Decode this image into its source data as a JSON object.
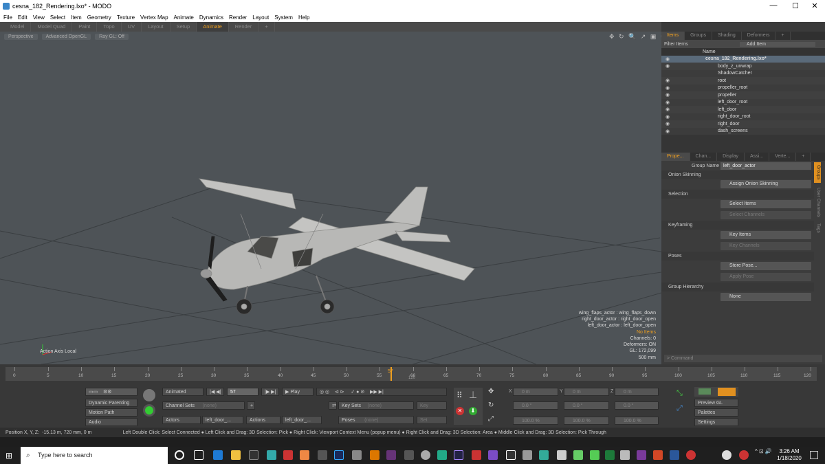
{
  "window": {
    "title": "cesna_182_Rendering.lxo* - MODO",
    "controls": [
      "—",
      "☐",
      "✕"
    ]
  },
  "menu": [
    "File",
    "Edit",
    "View",
    "Select",
    "Item",
    "Geometry",
    "Texture",
    "Vertex Map",
    "Animate",
    "Dynamics",
    "Render",
    "Layout",
    "System",
    "Help"
  ],
  "layout_tabs": [
    "Model",
    "Model Quad",
    "Paint",
    "Topo",
    "UV",
    "Layout",
    "Setup",
    "Animate",
    "Render",
    "+"
  ],
  "active_layout_tab": "Animate",
  "viewport": {
    "view": "Perspective",
    "shading": "Advanced OpenGL",
    "raygl": "Ray GL: Off",
    "axis_label": "Action Axis Local",
    "overlay": [
      "wing_flaps_actor : wing_flaps_down",
      "right_door_actor : right_door_open",
      "left_door_actor : left_door_open"
    ],
    "no_items": "No Items",
    "stats": [
      "Channels: 0",
      "Deformers: ON",
      "GL: 172,099",
      "500 mm"
    ],
    "tools": "✥ ↻ 🔍 ↗ ▣ ⚙"
  },
  "items_panel": {
    "tabs": [
      "Items",
      "Groups",
      "Shading",
      "Deformers",
      "+"
    ],
    "filter_placeholder": "Filter Items",
    "add_item": "Add Item",
    "name_header": "Name",
    "items": [
      "cesna_182_Rendering.lxo*",
      "body_z_unwrap",
      "ShadowCatcher",
      "root",
      "propeller_root",
      "propeller",
      "left_door_root",
      "left_door",
      "right_door_root",
      "right_door",
      "dash_screens"
    ]
  },
  "properties_panel": {
    "tabs": [
      "Prope...",
      "Chan...",
      "Display",
      "Assi...",
      "Verte...",
      "+"
    ],
    "group_name_label": "Group Name",
    "group_name_value": "left_door_actor",
    "sections": [
      "Onion Skinning",
      "Selection",
      "Keyframing",
      "Poses",
      "Group Hierarchy"
    ],
    "buttons": [
      "Assign Onion Skinning",
      "Select Items",
      "Select Channels",
      "Key Items",
      "Key Channels",
      "Store Pose...",
      "Apply Pose",
      "None"
    ],
    "side_tabs": [
      "Groups",
      "User Channels",
      "Tags"
    ],
    "command_placeholder": "Command"
  },
  "timeline": {
    "ticks": [
      "0",
      "5",
      "10",
      "15",
      "20",
      "25",
      "30",
      "35",
      "40",
      "45",
      "50",
      "55",
      "60",
      "65",
      "70",
      "75",
      "80",
      "85",
      "90",
      "95",
      "100",
      "105",
      "110",
      "115",
      "120"
    ],
    "current": "57",
    "end_marker": "120"
  },
  "transport": {
    "left_buttons": [
      "Dynamic Parenting",
      "Motion Path",
      "Audio"
    ],
    "mode": "Animated",
    "frame": "57",
    "play": "Play",
    "channel_sets": "Channel Sets",
    "channel_sets_value": "(none)",
    "key_sets": "Key Sets",
    "key_sets_value": "(none)",
    "key": "Key",
    "actors": "Actors",
    "actor_value": "left_door_...",
    "actions": "Actions",
    "action_value": "left_door_...",
    "poses": "Poses",
    "poses_value": "(none)",
    "set": "Set",
    "xyz_rows": [
      [
        "0 m",
        "0 m",
        "0 m"
      ],
      [
        "0.0 °",
        "0.0 °",
        "0.0 °"
      ],
      [
        "100.0 %",
        "100.0 %",
        "100.0 %"
      ]
    ],
    "axis_labels": [
      "X",
      "Y",
      "Z"
    ],
    "right_buttons": [
      "Preview GL",
      "Palettes",
      "Settings"
    ]
  },
  "status": {
    "position_label": "Position X, Y, Z:",
    "position_value": "-15.13 m, 720 mm, 0 m",
    "hints": "Left Double Click: Select Connected ● Left Click and Drag: 3D Selection: Pick ● Right Click: Viewport Context Menu (popup menu) ● Right Click and Drag: 3D Selection: Area ● Middle Click and Drag: 3D Selection: Pick Through"
  },
  "taskbar": {
    "search_placeholder": "Type here to search",
    "time": "3:26 AM",
    "date": "1/18/2020"
  }
}
